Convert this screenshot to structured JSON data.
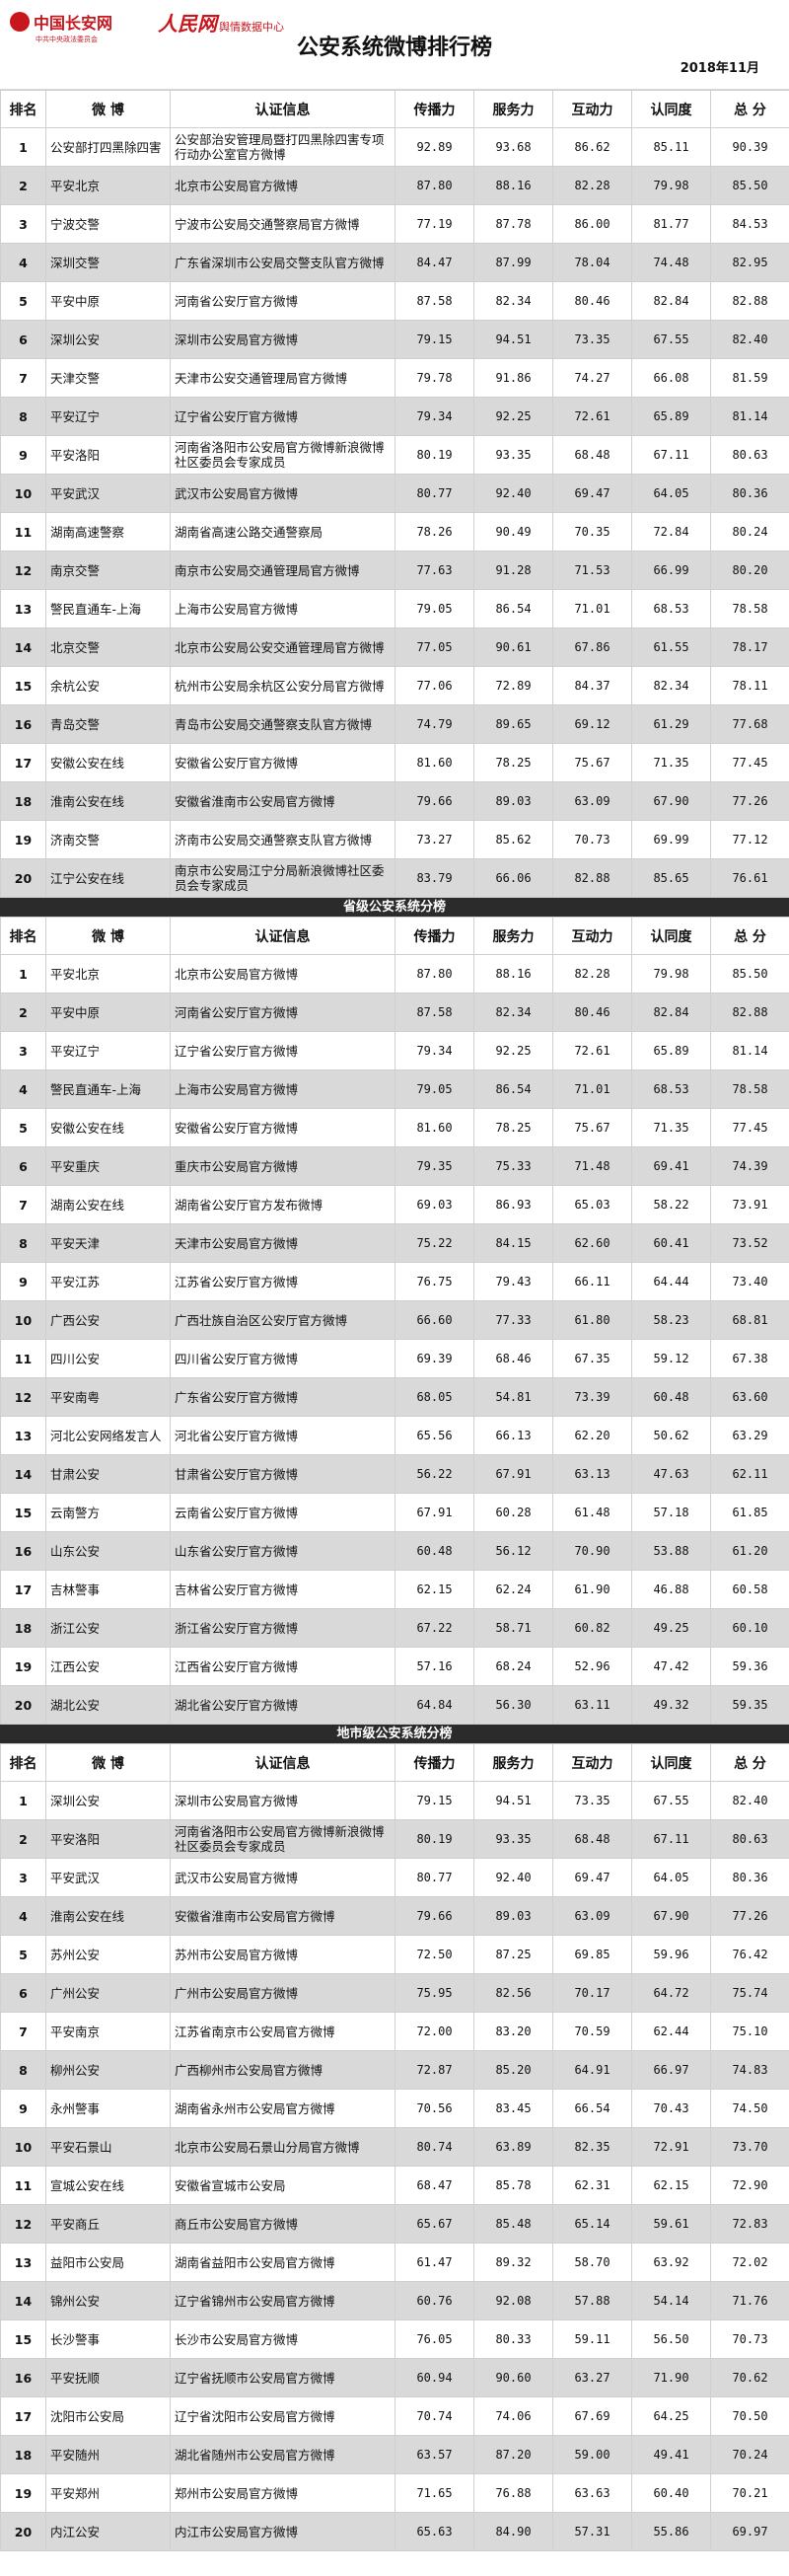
{
  "header": {
    "logo1_name": "中国长安网",
    "logo1_sub": "中共中央政法委员会",
    "logo2_name": "人民网",
    "logo2_sub": "舆情数据中心",
    "title": "公安系统微博排行榜",
    "date": "2018年11月"
  },
  "columns": [
    "排名",
    "微 博",
    "认证信息",
    "传播力",
    "服务力",
    "互动力",
    "认同度",
    "总 分"
  ],
  "sections": [
    {
      "title": "",
      "rows": [
        [
          "1",
          "公安部打四黑除四害",
          "公安部治安管理局暨打四黑除四害专项行动办公室官方微博",
          "92.89",
          "93.68",
          "86.62",
          "85.11",
          "90.39"
        ],
        [
          "2",
          "平安北京",
          "北京市公安局官方微博",
          "87.80",
          "88.16",
          "82.28",
          "79.98",
          "85.50"
        ],
        [
          "3",
          "宁波交警",
          "宁波市公安局交通警察局官方微博",
          "77.19",
          "87.78",
          "86.00",
          "81.77",
          "84.53"
        ],
        [
          "4",
          "深圳交警",
          "广东省深圳市公安局交警支队官方微博",
          "84.47",
          "87.99",
          "78.04",
          "74.48",
          "82.95"
        ],
        [
          "5",
          "平安中原",
          "河南省公安厅官方微博",
          "87.58",
          "82.34",
          "80.46",
          "82.84",
          "82.88"
        ],
        [
          "6",
          "深圳公安",
          "深圳市公安局官方微博",
          "79.15",
          "94.51",
          "73.35",
          "67.55",
          "82.40"
        ],
        [
          "7",
          "天津交警",
          "天津市公安交通管理局官方微博",
          "79.78",
          "91.86",
          "74.27",
          "66.08",
          "81.59"
        ],
        [
          "8",
          "平安辽宁",
          "辽宁省公安厅官方微博",
          "79.34",
          "92.25",
          "72.61",
          "65.89",
          "81.14"
        ],
        [
          "9",
          "平安洛阳",
          "河南省洛阳市公安局官方微博新浪微博社区委员会专家成员",
          "80.19",
          "93.35",
          "68.48",
          "67.11",
          "80.63"
        ],
        [
          "10",
          "平安武汉",
          "武汉市公安局官方微博",
          "80.77",
          "92.40",
          "69.47",
          "64.05",
          "80.36"
        ],
        [
          "11",
          "湖南高速警察",
          "湖南省高速公路交通警察局",
          "78.26",
          "90.49",
          "70.35",
          "72.84",
          "80.24"
        ],
        [
          "12",
          "南京交警",
          "南京市公安局交通管理局官方微博",
          "77.63",
          "91.28",
          "71.53",
          "66.99",
          "80.20"
        ],
        [
          "13",
          "警民直通车-上海",
          "上海市公安局官方微博",
          "79.05",
          "86.54",
          "71.01",
          "68.53",
          "78.58"
        ],
        [
          "14",
          "北京交警",
          "北京市公安局公安交通管理局官方微博",
          "77.05",
          "90.61",
          "67.86",
          "61.55",
          "78.17"
        ],
        [
          "15",
          "余杭公安",
          "杭州市公安局余杭区公安分局官方微博",
          "77.06",
          "72.89",
          "84.37",
          "82.34",
          "78.11"
        ],
        [
          "16",
          "青岛交警",
          "青岛市公安局交通警察支队官方微博",
          "74.79",
          "89.65",
          "69.12",
          "61.29",
          "77.68"
        ],
        [
          "17",
          "安徽公安在线",
          "安徽省公安厅官方微博",
          "81.60",
          "78.25",
          "75.67",
          "71.35",
          "77.45"
        ],
        [
          "18",
          "淮南公安在线",
          "安徽省淮南市公安局官方微博",
          "79.66",
          "89.03",
          "63.09",
          "67.90",
          "77.26"
        ],
        [
          "19",
          "济南交警",
          "济南市公安局交通警察支队官方微博",
          "73.27",
          "85.62",
          "70.73",
          "69.99",
          "77.12"
        ],
        [
          "20",
          "江宁公安在线",
          "南京市公安局江宁分局新浪微博社区委员会专家成员",
          "83.79",
          "66.06",
          "82.88",
          "85.65",
          "76.61"
        ]
      ]
    },
    {
      "title": "省级公安系统分榜",
      "rows": [
        [
          "1",
          "平安北京",
          "北京市公安局官方微博",
          "87.80",
          "88.16",
          "82.28",
          "79.98",
          "85.50"
        ],
        [
          "2",
          "平安中原",
          "河南省公安厅官方微博",
          "87.58",
          "82.34",
          "80.46",
          "82.84",
          "82.88"
        ],
        [
          "3",
          "平安辽宁",
          "辽宁省公安厅官方微博",
          "79.34",
          "92.25",
          "72.61",
          "65.89",
          "81.14"
        ],
        [
          "4",
          "警民直通车-上海",
          "上海市公安局官方微博",
          "79.05",
          "86.54",
          "71.01",
          "68.53",
          "78.58"
        ],
        [
          "5",
          "安徽公安在线",
          "安徽省公安厅官方微博",
          "81.60",
          "78.25",
          "75.67",
          "71.35",
          "77.45"
        ],
        [
          "6",
          "平安重庆",
          "重庆市公安局官方微博",
          "79.35",
          "75.33",
          "71.48",
          "69.41",
          "74.39"
        ],
        [
          "7",
          "湖南公安在线",
          "湖南省公安厅官方发布微博",
          "69.03",
          "86.93",
          "65.03",
          "58.22",
          "73.91"
        ],
        [
          "8",
          "平安天津",
          "天津市公安局官方微博",
          "75.22",
          "84.15",
          "62.60",
          "60.41",
          "73.52"
        ],
        [
          "9",
          "平安江苏",
          "江苏省公安厅官方微博",
          "76.75",
          "79.43",
          "66.11",
          "64.44",
          "73.40"
        ],
        [
          "10",
          "广西公安",
          "广西壮族自治区公安厅官方微博",
          "66.60",
          "77.33",
          "61.80",
          "58.23",
          "68.81"
        ],
        [
          "11",
          "四川公安",
          "四川省公安厅官方微博",
          "69.39",
          "68.46",
          "67.35",
          "59.12",
          "67.38"
        ],
        [
          "12",
          "平安南粤",
          "广东省公安厅官方微博",
          "68.05",
          "54.81",
          "73.39",
          "60.48",
          "63.60"
        ],
        [
          "13",
          "河北公安网络发言人",
          "河北省公安厅官方微博",
          "65.56",
          "66.13",
          "62.20",
          "50.62",
          "63.29"
        ],
        [
          "14",
          "甘肃公安",
          "甘肃省公安厅官方微博",
          "56.22",
          "67.91",
          "63.13",
          "47.63",
          "62.11"
        ],
        [
          "15",
          "云南警方",
          "云南省公安厅官方微博",
          "67.91",
          "60.28",
          "61.48",
          "57.18",
          "61.85"
        ],
        [
          "16",
          "山东公安",
          "山东省公安厅官方微博",
          "60.48",
          "56.12",
          "70.90",
          "53.88",
          "61.20"
        ],
        [
          "17",
          "吉林警事",
          "吉林省公安厅官方微博",
          "62.15",
          "62.24",
          "61.90",
          "46.88",
          "60.58"
        ],
        [
          "18",
          "浙江公安",
          "浙江省公安厅官方微博",
          "67.22",
          "58.71",
          "60.82",
          "49.25",
          "60.10"
        ],
        [
          "19",
          "江西公安",
          "江西省公安厅官方微博",
          "57.16",
          "68.24",
          "52.96",
          "47.42",
          "59.36"
        ],
        [
          "20",
          "湖北公安",
          "湖北省公安厅官方微博",
          "64.84",
          "56.30",
          "63.11",
          "49.32",
          "59.35"
        ]
      ]
    },
    {
      "title": "地市级公安系统分榜",
      "rows": [
        [
          "1",
          "深圳公安",
          "深圳市公安局官方微博",
          "79.15",
          "94.51",
          "73.35",
          "67.55",
          "82.40"
        ],
        [
          "2",
          "平安洛阳",
          "河南省洛阳市公安局官方微博新浪微博社区委员会专家成员",
          "80.19",
          "93.35",
          "68.48",
          "67.11",
          "80.63"
        ],
        [
          "3",
          "平安武汉",
          "武汉市公安局官方微博",
          "80.77",
          "92.40",
          "69.47",
          "64.05",
          "80.36"
        ],
        [
          "4",
          "淮南公安在线",
          "安徽省淮南市公安局官方微博",
          "79.66",
          "89.03",
          "63.09",
          "67.90",
          "77.26"
        ],
        [
          "5",
          "苏州公安",
          "苏州市公安局官方微博",
          "72.50",
          "87.25",
          "69.85",
          "59.96",
          "76.42"
        ],
        [
          "6",
          "广州公安",
          "广州市公安局官方微博",
          "75.95",
          "82.56",
          "70.17",
          "64.72",
          "75.74"
        ],
        [
          "7",
          "平安南京",
          "江苏省南京市公安局官方微博",
          "72.00",
          "83.20",
          "70.59",
          "62.44",
          "75.10"
        ],
        [
          "8",
          "柳州公安",
          "广西柳州市公安局官方微博",
          "72.87",
          "85.20",
          "64.91",
          "66.97",
          "74.83"
        ],
        [
          "9",
          "永州警事",
          "湖南省永州市公安局官方微博",
          "70.56",
          "83.45",
          "66.54",
          "70.43",
          "74.50"
        ],
        [
          "10",
          "平安石景山",
          "北京市公安局石景山分局官方微博",
          "80.74",
          "63.89",
          "82.35",
          "72.91",
          "73.70"
        ],
        [
          "11",
          "宣城公安在线",
          "安徽省宣城市公安局",
          "68.47",
          "85.78",
          "62.31",
          "62.15",
          "72.90"
        ],
        [
          "12",
          "平安商丘",
          "商丘市公安局官方微博",
          "65.67",
          "85.48",
          "65.14",
          "59.61",
          "72.83"
        ],
        [
          "13",
          "益阳市公安局",
          "湖南省益阳市公安局官方微博",
          "61.47",
          "89.32",
          "58.70",
          "63.92",
          "72.02"
        ],
        [
          "14",
          "锦州公安",
          "辽宁省锦州市公安局官方微博",
          "60.76",
          "92.08",
          "57.88",
          "54.14",
          "71.76"
        ],
        [
          "15",
          "长沙警事",
          "长沙市公安局官方微博",
          "76.05",
          "80.33",
          "59.11",
          "56.50",
          "70.73"
        ],
        [
          "16",
          "平安抚顺",
          "辽宁省抚顺市公安局官方微博",
          "60.94",
          "90.60",
          "63.27",
          "71.90",
          "70.62"
        ],
        [
          "17",
          "沈阳市公安局",
          "辽宁省沈阳市公安局官方微博",
          "70.74",
          "74.06",
          "67.69",
          "64.25",
          "70.50"
        ],
        [
          "18",
          "平安随州",
          "湖北省随州市公安局官方微博",
          "63.57",
          "87.20",
          "59.00",
          "49.41",
          "70.24"
        ],
        [
          "19",
          "平安郑州",
          "郑州市公安局官方微博",
          "71.65",
          "76.88",
          "63.63",
          "60.40",
          "70.21"
        ],
        [
          "20",
          "内江公安",
          "内江市公安局官方微博",
          "65.63",
          "84.90",
          "57.31",
          "55.86",
          "69.97"
        ]
      ]
    }
  ]
}
